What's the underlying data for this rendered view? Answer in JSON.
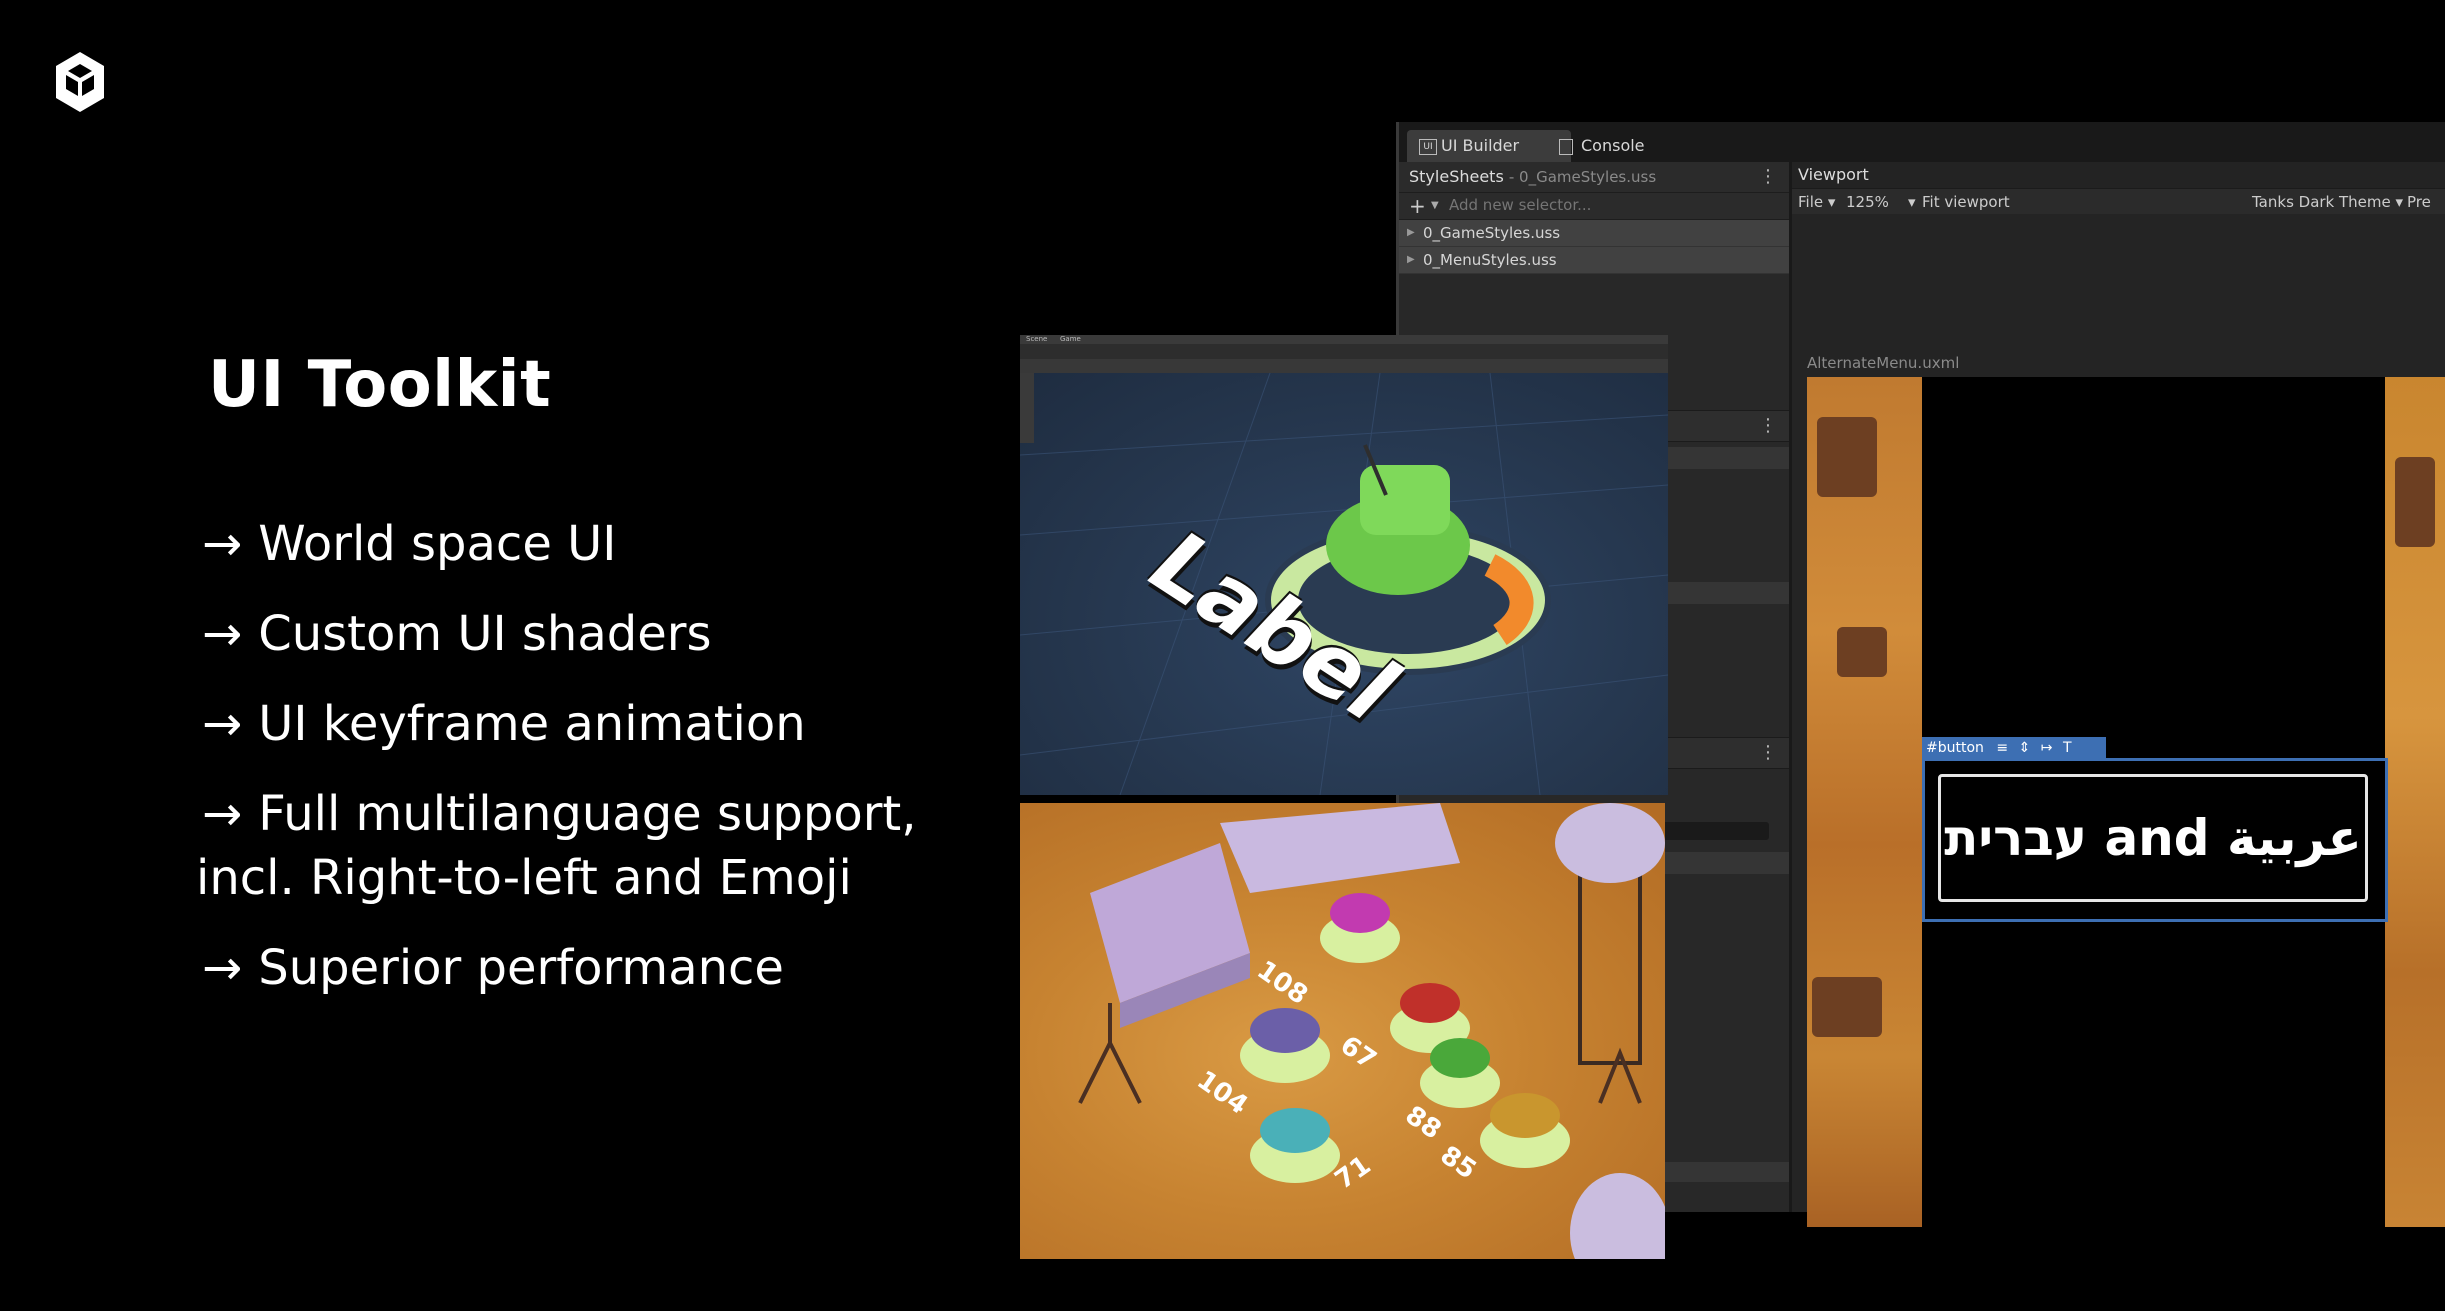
{
  "slide": {
    "title": "UI Toolkit",
    "bullets": [
      {
        "arrow": "→",
        "text": "World space UI"
      },
      {
        "arrow": "→",
        "text": "Custom UI shaders"
      },
      {
        "arrow": "→",
        "text": "UI keyframe animation"
      },
      {
        "arrow": "→",
        "text": "Full multilanguage support,"
      },
      {
        "arrow": "",
        "text": "incl. Right-to-left and Emoji"
      },
      {
        "arrow": "→",
        "text": "Superior performance"
      }
    ]
  },
  "logo": {
    "icon": "unity-cube-icon"
  },
  "editor": {
    "tabs": [
      {
        "label": "UI Builder",
        "icon": "ui-builder-icon",
        "active": true
      },
      {
        "label": "Console",
        "icon": "console-icon",
        "active": false
      }
    ],
    "stylesheets": {
      "header": "StyleSheets",
      "current": "- 0_GameStyles.uss",
      "add_placeholder": "Add new selector...",
      "files": [
        "0_GameStyles.uss",
        "0_MenuStyles.uss"
      ]
    },
    "viewport": {
      "header": "Viewport",
      "file_menu": "File ▾",
      "zoom": "125%",
      "zoom_caret": "▾",
      "fit_label": "Fit viewport",
      "theme": "Tanks Dark Theme ▾",
      "preview_partial": "Pre",
      "document": "AlternateMenu.uxml",
      "button_selector": "#button",
      "button_text": "עברית and عربية"
    }
  },
  "scene": {
    "world_label": "Label",
    "tab_scene": "Scene",
    "tab_game": "Game"
  },
  "game": {
    "scores": [
      "108",
      "67",
      "104",
      "71",
      "88",
      "85"
    ]
  },
  "colors": {
    "background": "#000000",
    "accent_blue": "#3d6fb3",
    "tank_green": "#6cc84a",
    "desert": "#c78331"
  }
}
